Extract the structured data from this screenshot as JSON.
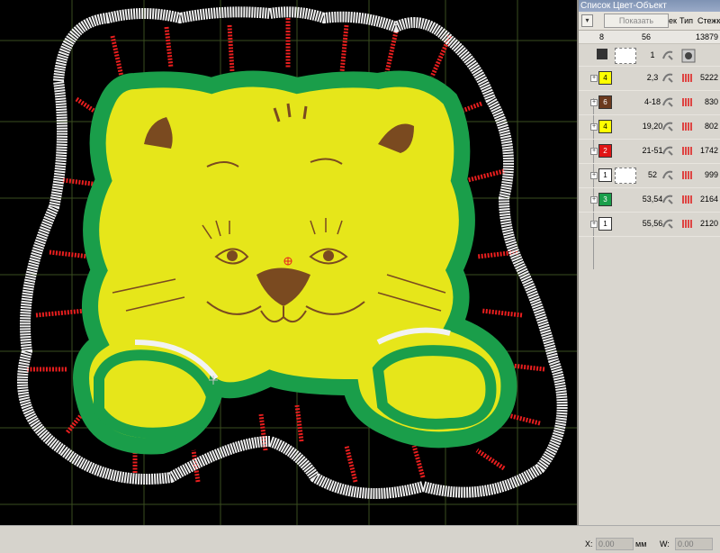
{
  "panel": {
    "title": "Список Цвет-Объект",
    "collapse_icon": "chevron-down-icon",
    "show_button": "Показать",
    "columns": {
      "nap": "ек",
      "type": "Тип",
      "stitches": "Стежк"
    },
    "totals": {
      "colors": "8",
      "objects": "56",
      "stitches": "13879"
    },
    "rows": [
      {
        "swatch": "",
        "color": "#ffffff",
        "seq": "1",
        "count": "",
        "kind": "background"
      },
      {
        "swatch": "4",
        "color": "#ffff00",
        "seq": "2,3",
        "count": "5222",
        "kind": "satin"
      },
      {
        "swatch": "6",
        "color": "#6b3a1e",
        "seq": "4-18",
        "count": "830",
        "kind": "run"
      },
      {
        "swatch": "4",
        "color": "#ffff00",
        "seq": "19,20",
        "count": "802",
        "kind": "satin"
      },
      {
        "swatch": "2",
        "color": "#e01515",
        "seq": "21-51",
        "count": "1742",
        "kind": "satin"
      },
      {
        "swatch": "1",
        "color": "#ffffff",
        "seq": "52",
        "count": "999",
        "kind": "applique"
      },
      {
        "swatch": "3",
        "color": "#1a9e4a",
        "seq": "53,54",
        "count": "2164",
        "kind": "satin"
      },
      {
        "swatch": "1",
        "color": "#ffffff",
        "seq": "55,56",
        "count": "2120",
        "kind": "satin"
      }
    ]
  },
  "statusbar": {
    "x_label": "X:",
    "x_value": "0.00",
    "x_unit": "мм",
    "w_label": "W:",
    "w_value": "0.00",
    "w_unit": "мм"
  },
  "colors": {
    "outline_green": "#1a9e4a",
    "fill_yellow": "#e6e61a",
    "tick_red": "#e81e1e",
    "edge_white": "#f2f2f2",
    "feature_brown": "#7a4a20"
  }
}
